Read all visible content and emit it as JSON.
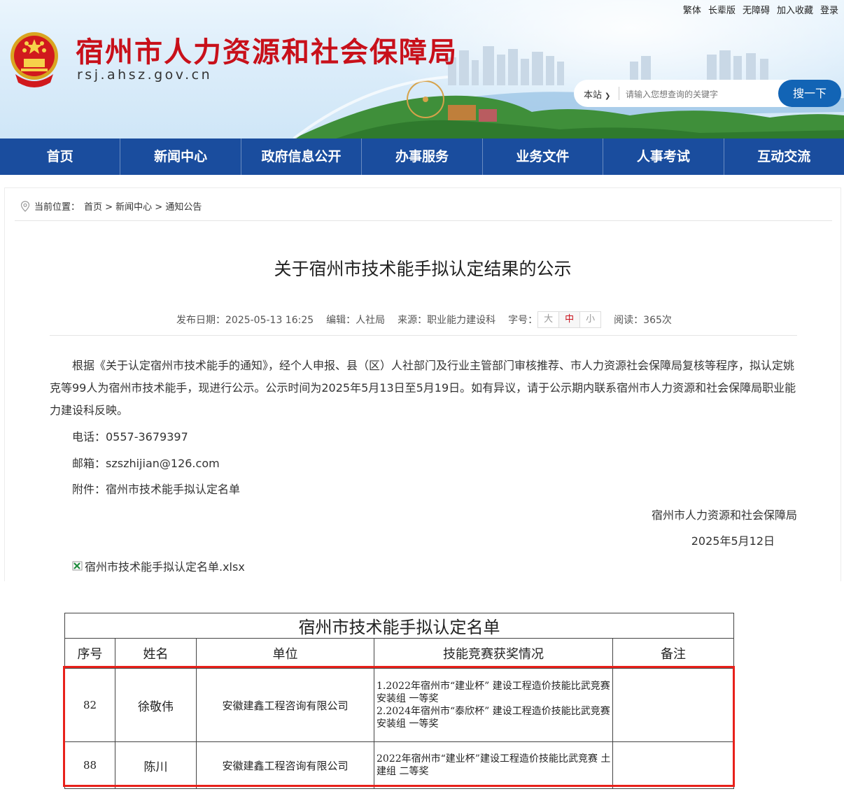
{
  "header": {
    "site_title": "宿州市人力资源和社会保障局",
    "site_url": "rsj.ahsz.gov.cn",
    "top_links": [
      "繁体",
      "长辈版",
      "无障碍",
      "加入收藏",
      "登录"
    ],
    "search": {
      "scope": "本站",
      "placeholder": "请输入您想查询的关键字",
      "button": "搜一下"
    }
  },
  "nav": [
    "首页",
    "新闻中心",
    "政府信息公开",
    "办事服务",
    "业务文件",
    "人事考试",
    "互动交流"
  ],
  "breadcrumb": {
    "prefix": "当前位置：",
    "path": "首页 > 新闻中心 > 通知公告"
  },
  "article": {
    "title": "关于宿州市技术能手拟认定结果的公示",
    "meta": {
      "date": "发布日期：2025-05-13 16:25",
      "editor": "编辑：人社局",
      "source": "来源：职业能力建设科",
      "font_label": "字号：",
      "font_sizes": [
        "大",
        "中",
        "小"
      ],
      "views": "阅读：365次"
    },
    "paragraph": "根据《关于认定宿州市技术能手的通知》，经个人申报、县（区）人社部门及行业主管部门审核推荐、市人力资源社会保障局复核等程序，拟认定姚克等99人为宿州市技术能手，现进行公示。公示时间为2025年5月13日至5月19日。如有异议，请于公示期内联系宿州市人力资源和社会保障局职业能力建设科反映。",
    "phone": "电话：0557-3679397",
    "email": "邮箱：szszhijian@126.com",
    "attachment_line": "附件：宿州市技术能手拟认定名单",
    "signature": "宿州市人力资源和社会保障局",
    "sign_date": "2025年5月12日",
    "attachment_file": "宿州市技术能手拟认定名单.xlsx"
  },
  "sheet": {
    "caption": "宿州市技术能手拟认定名单",
    "headers": [
      "序号",
      "姓名",
      "单位",
      "技能竞赛获奖情况",
      "备注"
    ],
    "rows": [
      {
        "no": "82",
        "name": "徐敬伟",
        "unit": "安徽建鑫工程咨询有限公司",
        "awards": [
          "1.2022年宿州市“建业杯” 建设工程造价技能比武竞赛 安装组 一等奖",
          "2.2024年宿州市“泰欣杯” 建设工程造价技能比武竞赛 安装组 一等奖"
        ],
        "note": ""
      },
      {
        "no": "88",
        "name": "陈川",
        "unit": "安徽建鑫工程咨询有限公司",
        "awards": [
          "2022年宿州市“建业杯”建设工程造价技能比武竞赛 土建组 二等奖"
        ],
        "note": ""
      }
    ]
  },
  "colors": {
    "title_red": "#c8101a",
    "nav_blue": "#1a4d9e",
    "search_blue": "#1264b5",
    "highlight_red": "#e8211b"
  }
}
